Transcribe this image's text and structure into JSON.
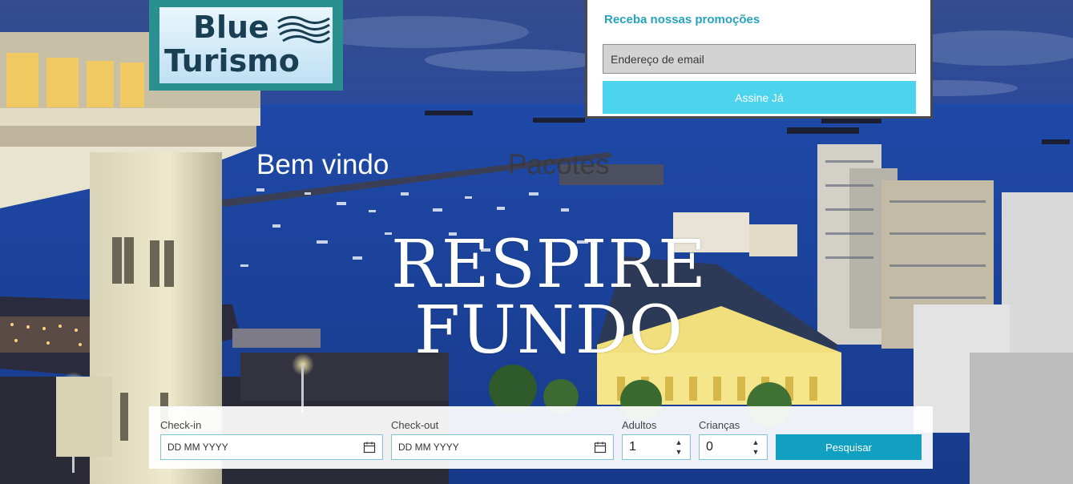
{
  "logo": {
    "line1": "Blue",
    "line2": "Turismo"
  },
  "newsletter": {
    "title": "Receba nossas promoções",
    "email_placeholder": "Endereço de email",
    "email_value": "",
    "button_label": "Assine Já"
  },
  "nav": {
    "welcome": "Bem vindo",
    "packages": "Pacotes"
  },
  "headline": {
    "line1": "RESPIRE",
    "line2": "FUNDO"
  },
  "booking": {
    "checkin_label": "Check-in",
    "checkin_value": "DD MM YYYY",
    "checkout_label": "Check-out",
    "checkout_value": "DD MM YYYY",
    "adults_label": "Adultos",
    "adults_value": "1",
    "children_label": "Crianças",
    "children_value": "0",
    "search_label": "Pesquisar"
  },
  "colors": {
    "accent": "#4cd4ee",
    "search_button": "#11a0c2",
    "newsletter_title": "#27a3bd",
    "logo_frame": "#2a8f8f"
  },
  "icons": [
    "calendar-icon",
    "wave-icon",
    "up-arrow-icon",
    "down-arrow-icon"
  ]
}
